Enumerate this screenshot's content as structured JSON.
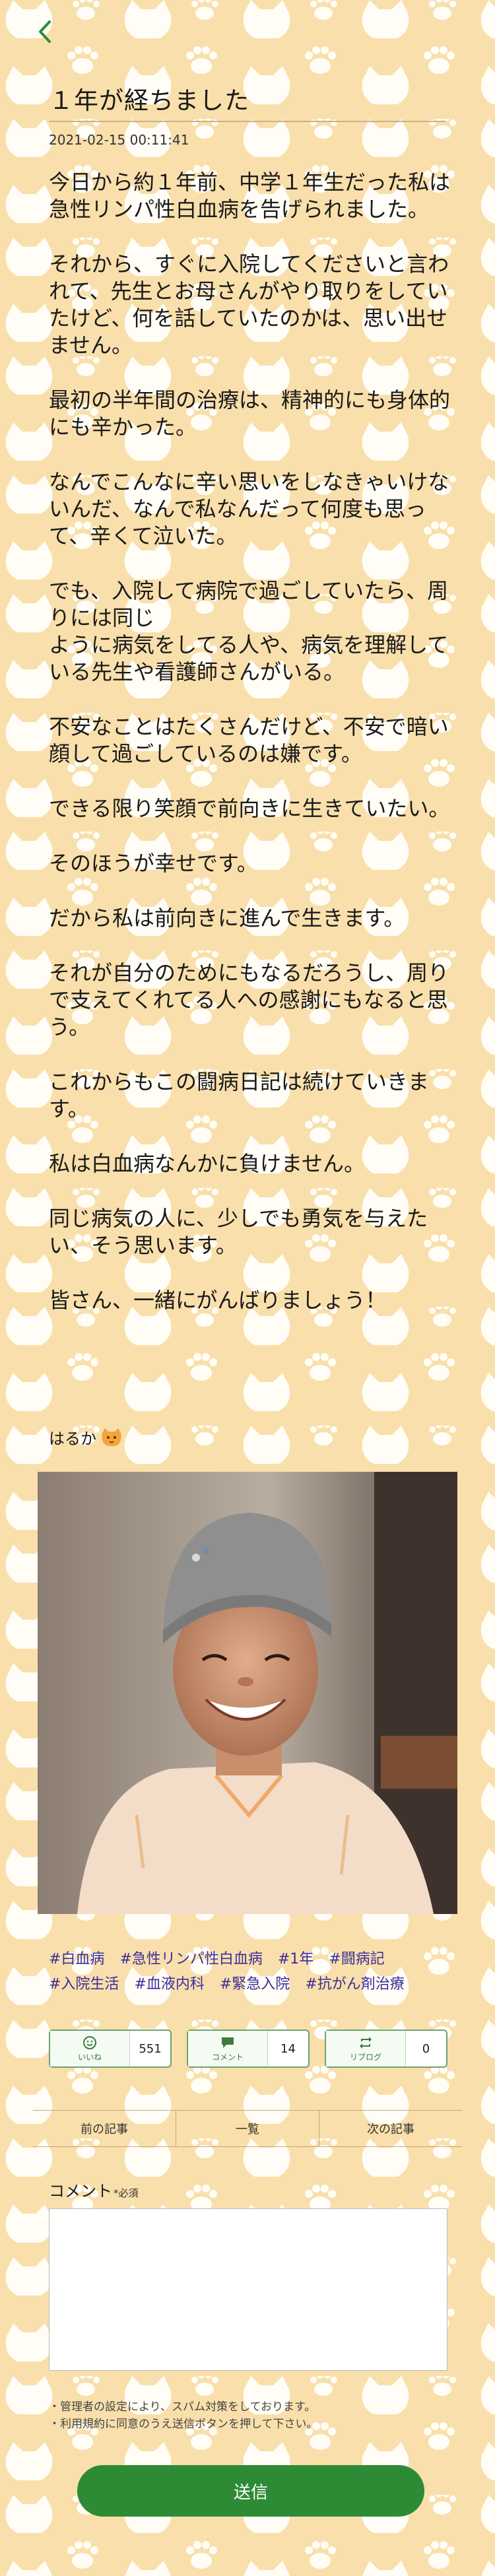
{
  "post": {
    "title": "１年が経ちました",
    "date": "2021-02-15 00:11:41",
    "paragraphs": [
      "今日から約１年前、中学１年生だった私は急性リンパ性白血病を告げられました。",
      "それから、すぐに入院してくださいと言われて、先生とお母さんがやり取りをしていたけど、何を話していたのかは、思い出せません。",
      "最初の半年間の治療は、精神的にも身体的にも辛かった。",
      "なんでこんなに辛い思いをしなきゃいけないんだ、なんで私なんだって何度も思って、辛くて泣いた。",
      "でも、入院して病院で過ごしていたら、周りには同じ\nように病気をしてる人や、病気を理解している先生や看護師さんがいる。",
      "不安なことはたくさんだけど、不安で暗い顔して過ごしているのは嫌です。",
      "できる限り笑顔で前向きに生きていたい。",
      "そのほうが幸せです。",
      "だから私は前向きに進んで生きます。",
      "それが自分のためにもなるだろうし、周りで支えてくれてる人への感謝にもなると思う。",
      "これからもこの闘病日記は続けていきます。",
      "",
      "私は白血病なんかに負けません。",
      "同じ病気の人に、少しでも勇気を与えたい、そう思います。",
      "皆さん、一緒にがんばりましょう！"
    ],
    "author": "はるか",
    "author_icon": "cat-face-icon"
  },
  "tags": [
    "#白血病",
    "#急性リンパ性白血病",
    "#1年",
    "#闘病記",
    "#入院生活",
    "#血液内科",
    "#緊急入院",
    "#抗がん剤治療"
  ],
  "reactions": {
    "like": {
      "label": "いいね",
      "count": "551"
    },
    "comment": {
      "label": "コメント",
      "count": "14"
    },
    "reblog": {
      "label": "リブログ",
      "count": "0"
    }
  },
  "nav": {
    "prev": "前の記事",
    "list": "一覧",
    "next": "次の記事"
  },
  "comment_form": {
    "label": "コメント",
    "required": "*必須",
    "value": "",
    "notes": [
      "・管理者の設定により、スパム対策をしております。",
      "・利用規約に同意のうえ送信ボタンを押して下さい。"
    ],
    "submit": "送信"
  },
  "colors": {
    "background": "#f9dfab",
    "pattern": "#ffffff",
    "accent_green": "#2d8a35",
    "tag_color": "#3a2d9c"
  }
}
